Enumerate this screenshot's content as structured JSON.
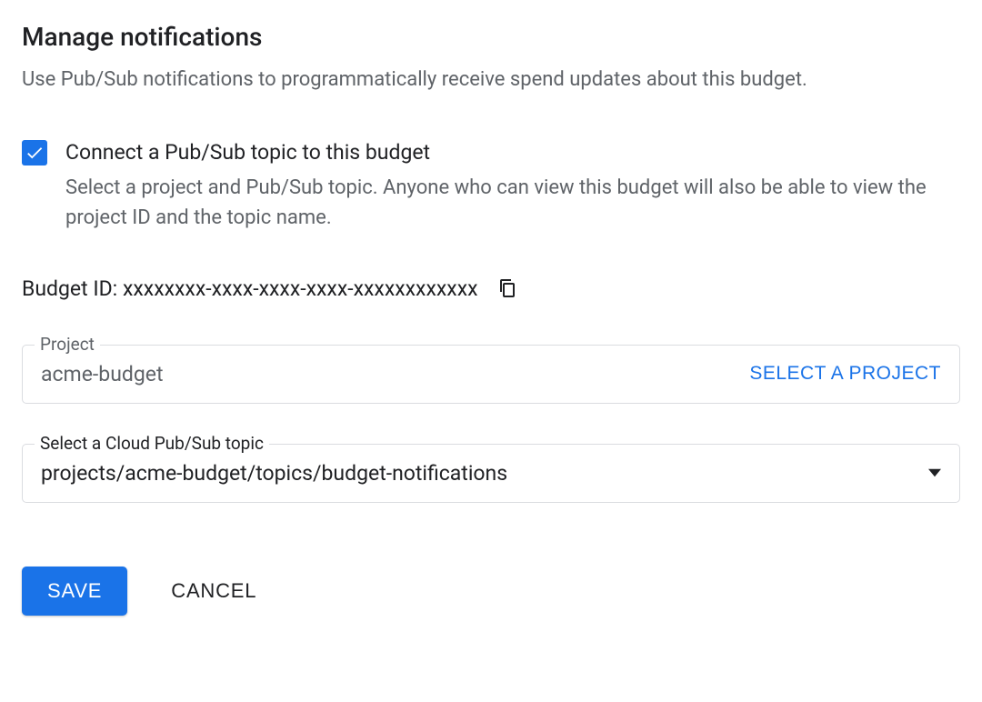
{
  "title": "Manage notifications",
  "description": "Use Pub/Sub notifications to programmatically receive spend updates about this budget.",
  "checkbox": {
    "label": "Connect a Pub/Sub topic to this budget",
    "description": "Select a project and Pub/Sub topic. Anyone who can view this budget will also be able to view the project ID and the topic name."
  },
  "budget_id": {
    "label": "Budget ID:",
    "value": "xxxxxxxx-xxxx-xxxx-xxxx-xxxxxxxxxxxx"
  },
  "project_field": {
    "label": "Project",
    "value": "acme-budget",
    "button": "SELECT A PROJECT"
  },
  "topic_field": {
    "label": "Select a Cloud Pub/Sub topic",
    "value": "projects/acme-budget/topics/budget-notifications"
  },
  "buttons": {
    "save": "SAVE",
    "cancel": "CANCEL"
  }
}
